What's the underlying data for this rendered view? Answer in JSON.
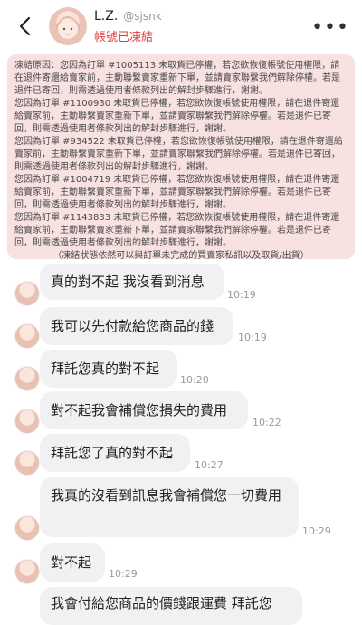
{
  "header": {
    "name": "L.Z.",
    "handle": "@sjsnk",
    "status": "帳號已凍結",
    "more_icon": "more-horizontal-icon",
    "back_icon": "chevron-left-icon"
  },
  "notice": {
    "lines": [
      "凍結原因：您因為訂單 #1005113 未取貨已停權，若您欲恢復帳號使用權限，請在退件寄還給賣家前，主動聯繫賣家重新下單，並請賣家聯繫我們解除停權。若是退件已寄回，則需透過使用者條款列出的解封步驟進行，謝謝。",
      "您因為訂單 #1100930 未取貨已停權，若您欲恢復帳號使用權限，請在退件寄還給賣家前，主動聯繫賣家重新下單，並請賣家聯繫我們解除停權。若是退件已寄回，則需透過使用者條款列出的解封步驟進行，謝謝。",
      "您因為訂單 #934522 未取貨已停權，若您欲恢復帳號使用權限，請在退件寄還給賣家前，主動聯繫賣家重新下單，並請賣家聯繫我們解除停權。若是退件已寄回，則需透過使用者條款列出的解封步驟進行，謝謝。",
      "您因為訂單 #1004719 未取貨已停權，若您欲恢復帳號使用權限，請在退件寄還給賣家前，主動聯繫賣家重新下單，並請賣家聯繫我們解除停權。若是退件已寄回，則需透過使用者條款列出的解封步驟進行，謝謝。",
      "您因為訂單 #1143833 未取貨已停權，若您欲恢復帳號使用權限，請在退件寄還給賣家前，主動聯繫賣家重新下單，並請賣家聯繫我們解除停權。若是退件已寄回，則需透過使用者條款列出的解封步驟進行，謝謝。"
    ],
    "footer": "（凍結狀態依然可以與訂單未完成的買賣家私訊以及取貨/出貨）"
  },
  "messages": [
    {
      "text": "真的對不起 我沒看到消息",
      "time": "10:19"
    },
    {
      "text": "我可以先付款給您商品的錢",
      "time": "10:19"
    },
    {
      "text": "拜託您真的對不起",
      "time": "10:20"
    },
    {
      "text": "對不起我會補償您損失的費用",
      "time": "10:22"
    },
    {
      "text": "拜託您了真的對不起",
      "time": "10:27"
    },
    {
      "text": "我真的沒看到訊息我會補償您一切費用",
      "time": "10:29"
    },
    {
      "text": "對不起",
      "time": "10:29"
    },
    {
      "text": "我會付給您商品的價錢跟運費 拜託您",
      "time": ""
    }
  ]
}
